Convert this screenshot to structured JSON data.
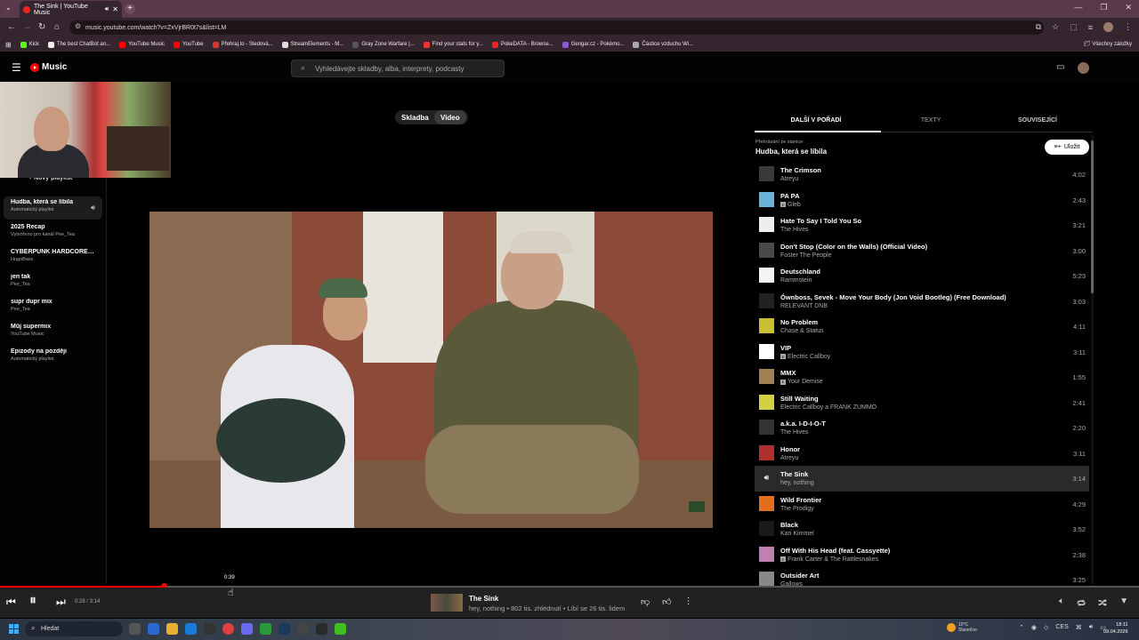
{
  "browser": {
    "tab_title": "The Sink | YouTube Music",
    "url": "music.youtube.com/watch?v=ZxVjrBR0t7s&list=LM",
    "bookmarks": [
      {
        "label": "Kick",
        "color": "#53fc18"
      },
      {
        "label": "The best ChatBot an...",
        "color": "#eee"
      },
      {
        "label": "YouTube Music",
        "color": "#f00"
      },
      {
        "label": "YouTube",
        "color": "#f00"
      },
      {
        "label": "Přehraj.to - Sledová...",
        "color": "#d33"
      },
      {
        "label": "StreamElements - M...",
        "color": "#ddd"
      },
      {
        "label": "Gray Zone Warfare |...",
        "color": "#555"
      },
      {
        "label": "Find your stats for y...",
        "color": "#e33"
      },
      {
        "label": "PokeDATA - Browse...",
        "color": "#e22"
      },
      {
        "label": "Gengar.cz - Pokémo...",
        "color": "#8a5ad0"
      },
      {
        "label": "Částice vzduchu Wi...",
        "color": "#aaa"
      }
    ],
    "all_bookmarks": "Všechny záložky"
  },
  "header": {
    "logo": "Music",
    "search_placeholder": "Vyhledávejte skladby, alba, interprety, podcasty"
  },
  "sidebar": {
    "new_playlist": "Nový playlist",
    "playlists": [
      {
        "title": "Hudba, která se líbila",
        "subtitle": "Automatický playlist",
        "active": true
      },
      {
        "title": "2025 Recap",
        "subtitle": "Vytvořeno pro kanál Pee_Tea"
      },
      {
        "title": "CYBERPUNK HARDCORE: Th...",
        "subtitle": "HugoBass"
      },
      {
        "title": "jen tak",
        "subtitle": "Pee_Tea"
      },
      {
        "title": "supr dupr mix",
        "subtitle": "Pee_Tea"
      },
      {
        "title": "Můj supermix",
        "subtitle": "YouTube Music"
      },
      {
        "title": "Epizody na později",
        "subtitle": "Automatický playlist"
      }
    ]
  },
  "toggle": {
    "song": "Skladba",
    "video": "Video"
  },
  "panel": {
    "tabs": [
      "DALŠÍ V POŘADÍ",
      "TEXTY",
      "SOUVISEJÍCÍ"
    ],
    "radio_from": "Přehrávání ze stanice",
    "radio_name": "Hudba, která se líbila",
    "save": "Uložit"
  },
  "queue": [
    {
      "title": "The Crimson",
      "artist": "Atreyu",
      "duration": "4:02",
      "explicit": false,
      "thumb": "#3a3a3a"
    },
    {
      "title": "PA PA",
      "artist": "Gleb",
      "duration": "2:43",
      "explicit": true,
      "thumb": "#6ab0d8"
    },
    {
      "title": "Hate To Say I Told You So",
      "artist": "The Hives",
      "duration": "3:21",
      "explicit": false,
      "thumb": "#eeeeee"
    },
    {
      "title": "Don't Stop (Color on the Walls) (Official Video)",
      "artist": "Foster The People",
      "duration": "3:00",
      "explicit": false,
      "thumb": "#4a4a4a"
    },
    {
      "title": "Deutschland",
      "artist": "Rammstein",
      "duration": "5:23",
      "explicit": false,
      "thumb": "#f4f4f4"
    },
    {
      "title": "Ównboss, Sevek - Move Your Body (Jon Void Bootleg) (Free Download)",
      "artist": "RELEVANT DNB",
      "duration": "3:03",
      "explicit": false,
      "thumb": "#222222"
    },
    {
      "title": "No Problem",
      "artist": "Chase & Status",
      "duration": "4:11",
      "explicit": false,
      "thumb": "#c8c030"
    },
    {
      "title": "VIP",
      "artist": "Electric Callboy",
      "duration": "3:11",
      "explicit": true,
      "thumb": "#ffffff"
    },
    {
      "title": "MMX",
      "artist": "Your Demise",
      "duration": "1:55",
      "explicit": true,
      "thumb": "#a08050"
    },
    {
      "title": "Still Waiting",
      "artist": "Electric Callboy a FRANK ZUMMO",
      "duration": "2:41",
      "explicit": false,
      "thumb": "#d0d040"
    },
    {
      "title": "a.k.a. I-D-I-O-T",
      "artist": "The Hives",
      "duration": "2:20",
      "explicit": false,
      "thumb": "#333333"
    },
    {
      "title": "Honor",
      "artist": "Atreyu",
      "duration": "3:11",
      "explicit": false,
      "thumb": "#b03030"
    },
    {
      "title": "The Sink",
      "artist": "hey, nothing",
      "duration": "3:14",
      "explicit": false,
      "thumb": "",
      "playing": true
    },
    {
      "title": "Wild Frontier",
      "artist": "The Prodigy",
      "duration": "4:29",
      "explicit": false,
      "thumb": "#e07020"
    },
    {
      "title": "Black",
      "artist": "Kari Kimmel",
      "duration": "3:52",
      "explicit": false,
      "thumb": "#1a1a1a"
    },
    {
      "title": "Off With His Head (feat. Cassyette)",
      "artist": "Frank Carter & The Rattlesnakes",
      "duration": "2:38",
      "explicit": true,
      "thumb": "#c080b0"
    },
    {
      "title": "Outsider Art",
      "artist": "Gallows",
      "duration": "3:25",
      "explicit": false,
      "thumb": "#888888"
    }
  ],
  "player": {
    "hover_time": "0:39",
    "time": "0:28 / 3:14",
    "progress": 0.144,
    "title": "The Sink",
    "subtitle": "hey, nothing • 802 tis. zhlédnutí • Líbí se 26 tis. lidem"
  },
  "taskbar": {
    "search": "Hledat",
    "weather_temp": "10°C",
    "weather_desc": "Slunečno",
    "lang": "CES",
    "time": "18:11",
    "date": "09.04.2026"
  }
}
